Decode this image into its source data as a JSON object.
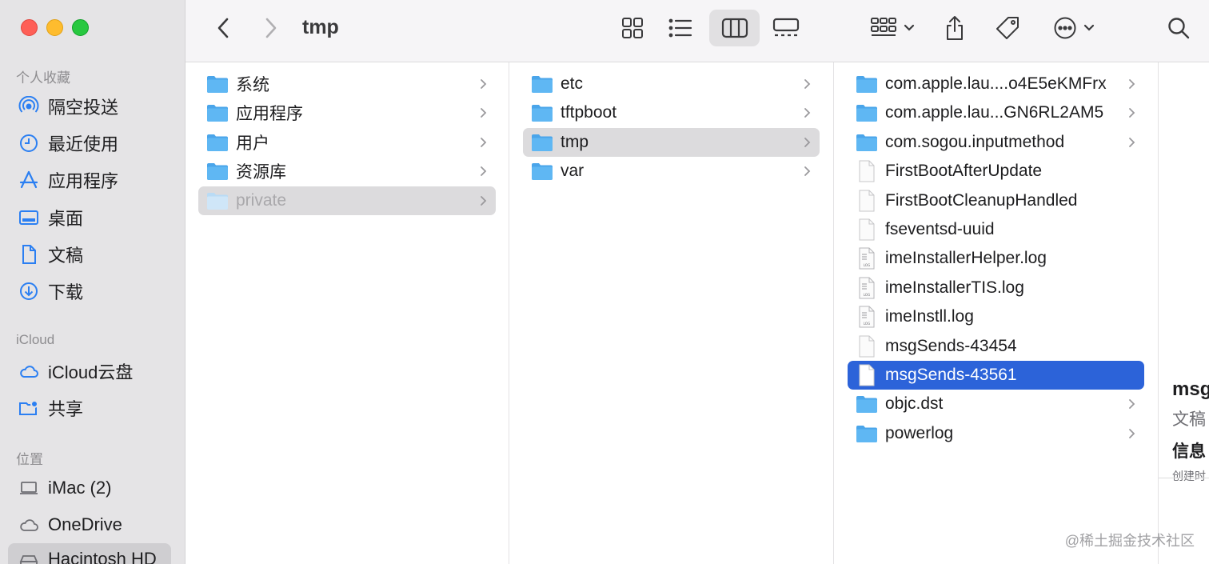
{
  "window": {
    "title": "tmp"
  },
  "sidebar": {
    "favorites_header": "个人收藏",
    "favorites": [
      {
        "label": "隔空投送",
        "icon": "airdrop-icon"
      },
      {
        "label": "最近使用",
        "icon": "recents-clock-icon"
      },
      {
        "label": "应用程序",
        "icon": "applications-icon"
      },
      {
        "label": "桌面",
        "icon": "desktop-icon"
      },
      {
        "label": "文稿",
        "icon": "document-icon"
      },
      {
        "label": "下载",
        "icon": "download-icon"
      }
    ],
    "icloud_header": "iCloud",
    "icloud": [
      {
        "label": "iCloud云盘",
        "icon": "cloud-icon"
      },
      {
        "label": "共享",
        "icon": "shared-folder-icon"
      }
    ],
    "locations_header": "位置",
    "locations": [
      {
        "label": "iMac (2)",
        "icon": "laptop-icon"
      },
      {
        "label": "OneDrive",
        "icon": "cloud-icon"
      },
      {
        "label": "Hacintosh HD",
        "icon": "disk-icon"
      }
    ]
  },
  "columns": {
    "col1": [
      {
        "label": "系统",
        "type": "folder",
        "chevron": true
      },
      {
        "label": "应用程序",
        "type": "folder",
        "chevron": true
      },
      {
        "label": "用户",
        "type": "folder",
        "chevron": true
      },
      {
        "label": "资源库",
        "type": "folder",
        "chevron": true
      },
      {
        "label": "private",
        "type": "folder",
        "chevron": true,
        "state": "path"
      }
    ],
    "col2": [
      {
        "label": "etc",
        "type": "folder",
        "chevron": true
      },
      {
        "label": "tftpboot",
        "type": "folder",
        "chevron": true
      },
      {
        "label": "tmp",
        "type": "folder",
        "chevron": true,
        "state": "path"
      },
      {
        "label": "var",
        "type": "folder",
        "chevron": true
      }
    ],
    "col3": [
      {
        "label": "com.apple.lau....o4E5eKMFrx",
        "type": "folder",
        "chevron": true
      },
      {
        "label": "com.apple.lau...GN6RL2AM5",
        "type": "folder",
        "chevron": true
      },
      {
        "label": "com.sogou.inputmethod",
        "type": "folder",
        "chevron": true
      },
      {
        "label": "FirstBootAfterUpdate",
        "type": "file",
        "chevron": false
      },
      {
        "label": "FirstBootCleanupHandled",
        "type": "file",
        "chevron": false
      },
      {
        "label": "fseventsd-uuid",
        "type": "file",
        "chevron": false
      },
      {
        "label": "imeInstallerHelper.log",
        "type": "log",
        "chevron": false
      },
      {
        "label": "imeInstallerTIS.log",
        "type": "log",
        "chevron": false
      },
      {
        "label": "imeInstll.log",
        "type": "log",
        "chevron": false
      },
      {
        "label": "msgSends-43454",
        "type": "file",
        "chevron": false
      },
      {
        "label": "msgSends-43561",
        "type": "file",
        "chevron": false,
        "state": "selected"
      },
      {
        "label": "objc.dst",
        "type": "folder",
        "chevron": true
      },
      {
        "label": "powerlog",
        "type": "folder",
        "chevron": true
      }
    ]
  },
  "preview": {
    "title": "msg",
    "kind": "文稿",
    "info_header": "信息",
    "created": "创建时"
  },
  "watermark": "@稀土掘金技术社区",
  "colors": {
    "selection": "#2c63d9",
    "folder": "#5fb7f3",
    "sidebar_bg": "#e5e4e6"
  }
}
